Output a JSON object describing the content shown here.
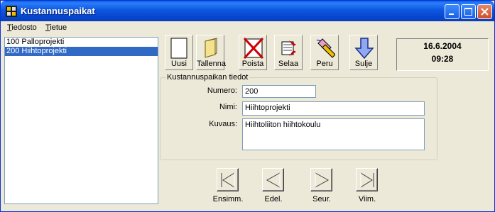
{
  "window": {
    "title": "Kustannuspaikat",
    "accent": "#0a5fdd"
  },
  "menu": {
    "items": [
      {
        "label_u": "T",
        "label_rest": "iedosto"
      },
      {
        "label_u": "T",
        "label_rest": "ietue"
      }
    ]
  },
  "list": {
    "items": [
      {
        "label": "100 Palloprojekti",
        "selected": false
      },
      {
        "label": "200 Hiihtoprojekti",
        "selected": true
      }
    ],
    "selection_color": "#316ac5"
  },
  "toolbar": {
    "buttons": [
      {
        "label": "Uusi",
        "icon": "new-document-icon"
      },
      {
        "label": "Tallenna",
        "icon": "folder-icon"
      },
      {
        "label": "Poista",
        "icon": "delete-x-icon"
      },
      {
        "label": "Selaa",
        "icon": "browse-icon"
      },
      {
        "label": "Peru",
        "icon": "eraser-pencil-icon"
      },
      {
        "label": "Sulje",
        "icon": "down-arrow-icon"
      }
    ]
  },
  "datetime": {
    "date": "16.6.2004",
    "time": "09:28"
  },
  "details": {
    "legend": "Kustannuspaikan tiedot",
    "numero_label": "Numero:",
    "numero_value": "200",
    "nimi_label": "Nimi:",
    "nimi_value": "Hiihtoprojekti",
    "kuvaus_label": "Kuvaus:",
    "kuvaus_value": "Hiihtoliiton hiihtokoulu"
  },
  "navigation": {
    "buttons": [
      {
        "label": "Ensimm.",
        "icon": "first-record-icon"
      },
      {
        "label": "Edel.",
        "icon": "previous-record-icon"
      },
      {
        "label": "Seur.",
        "icon": "next-record-icon"
      },
      {
        "label": "Viim.",
        "icon": "last-record-icon"
      }
    ]
  }
}
